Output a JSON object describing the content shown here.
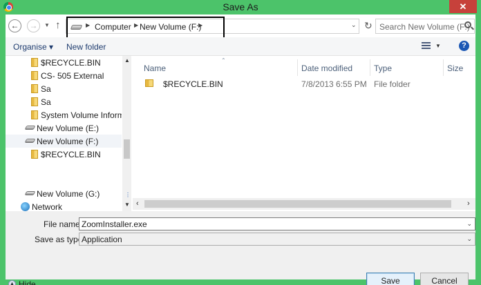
{
  "window": {
    "title": "Save As",
    "close_label": "✕"
  },
  "address_bar": {
    "breadcrumbs": [
      "Computer",
      "New Volume (F:)"
    ],
    "search_placeholder": "Search New Volume (F:)"
  },
  "toolbar": {
    "organise_label": "Organise ▾",
    "new_folder_label": "New folder",
    "help_label": "?"
  },
  "nav_tree": {
    "items": [
      {
        "label": "$RECYCLE.BIN",
        "icon": "folder-icon"
      },
      {
        "label": "CS- 505 External",
        "icon": "folder-icon"
      },
      {
        "label": "Sa",
        "icon": "folder-icon"
      },
      {
        "label": "Sa",
        "icon": "folder-icon"
      },
      {
        "label": "System Volume Informati",
        "icon": "folder-icon"
      },
      {
        "label": "New Volume (E:)",
        "icon": "drive-icon"
      },
      {
        "label": "New Volume (F:)",
        "icon": "drive-icon",
        "selected": true
      },
      {
        "label": "$RECYCLE.BIN",
        "icon": "folder-icon"
      },
      {
        "label": "New Volume (G:)",
        "icon": "drive-icon"
      },
      {
        "label": "Network",
        "icon": "network-icon"
      }
    ]
  },
  "file_list": {
    "columns": [
      "Name",
      "Date modified",
      "Type",
      "Size"
    ],
    "rows": [
      {
        "name": "$RECYCLE.BIN",
        "date": "7/8/2013 6:55 PM",
        "type": "File folder",
        "size": ""
      }
    ]
  },
  "form": {
    "filename_label": "File name:",
    "filename_value": "ZoomInstaller.exe",
    "savetype_label": "Save as type:",
    "savetype_value": "Application"
  },
  "footer": {
    "hide_folders_label": "Hide Folders",
    "save_label": "Save",
    "cancel_label": "Cancel"
  },
  "colors": {
    "window_frame": "#4cc36a",
    "close_button": "#c7413b",
    "link_text": "#1e3b6e"
  }
}
